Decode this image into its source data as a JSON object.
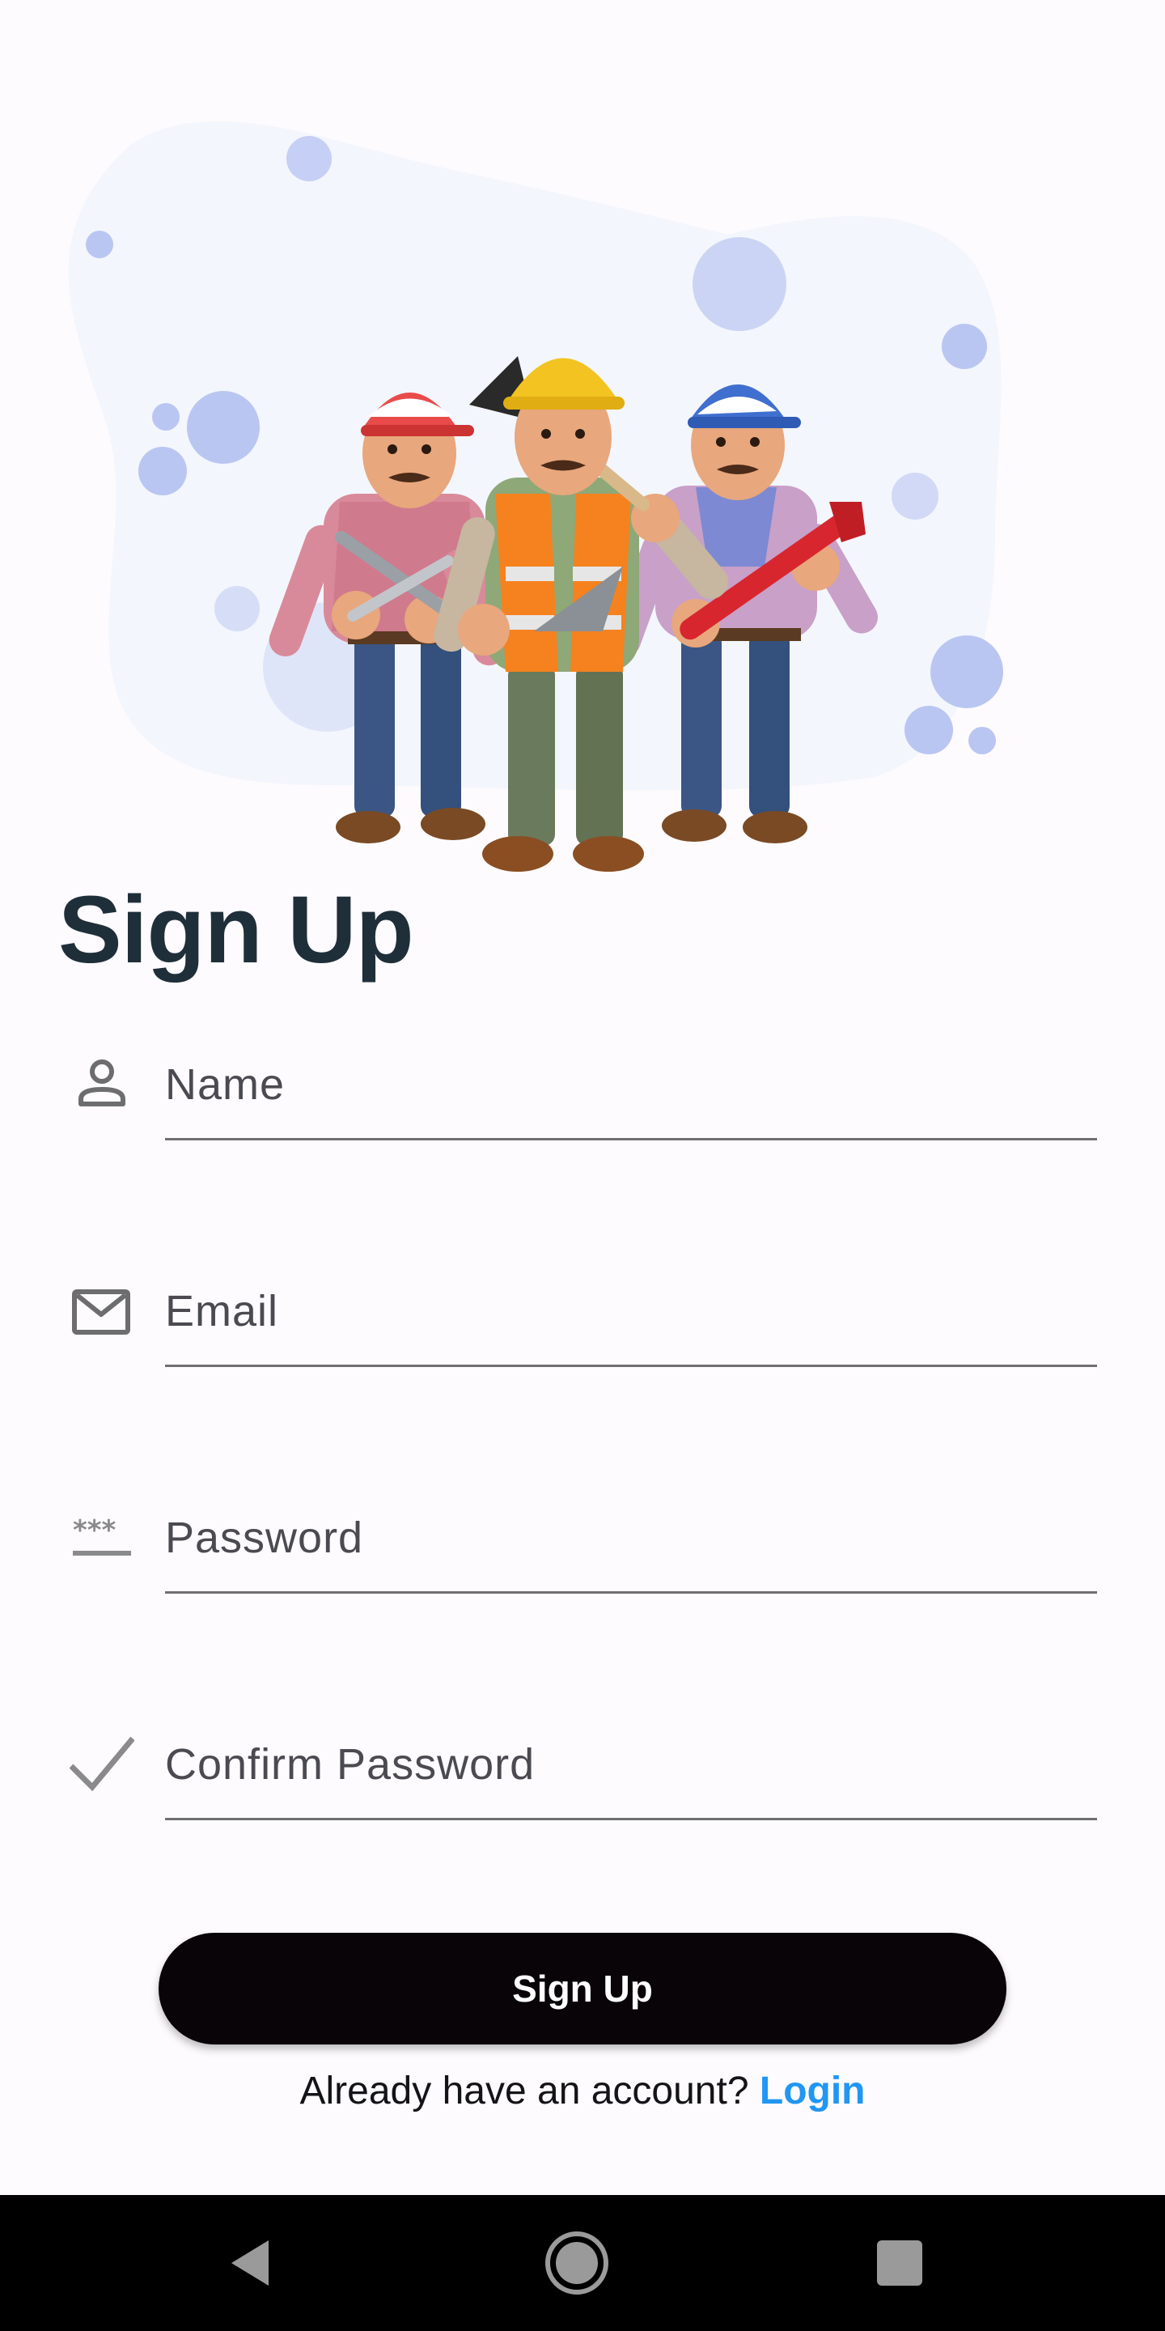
{
  "page": {
    "title": "Sign Up"
  },
  "hero": {
    "illustration": "three-construction-workers-illustration"
  },
  "form": {
    "fields": [
      {
        "icon": "person-icon",
        "placeholder": "Name",
        "value": ""
      },
      {
        "icon": "mail-icon",
        "placeholder": "Email",
        "value": ""
      },
      {
        "icon": "password-icon",
        "placeholder": "Password",
        "value": ""
      },
      {
        "icon": "check-icon",
        "placeholder": "Confirm Password",
        "value": ""
      }
    ],
    "submit_label": "Sign Up"
  },
  "footer": {
    "prompt": "Already have an account? ",
    "link_label": "Login"
  },
  "colors": {
    "background": "#fdfbfd",
    "title": "#1f2f3a",
    "button": "#080408",
    "link": "#2196f3",
    "blob": "#f4f6fc",
    "bubble": "#bac6f2"
  },
  "nav": {
    "back": "back-icon",
    "home": "home-icon",
    "recents": "recents-icon"
  }
}
